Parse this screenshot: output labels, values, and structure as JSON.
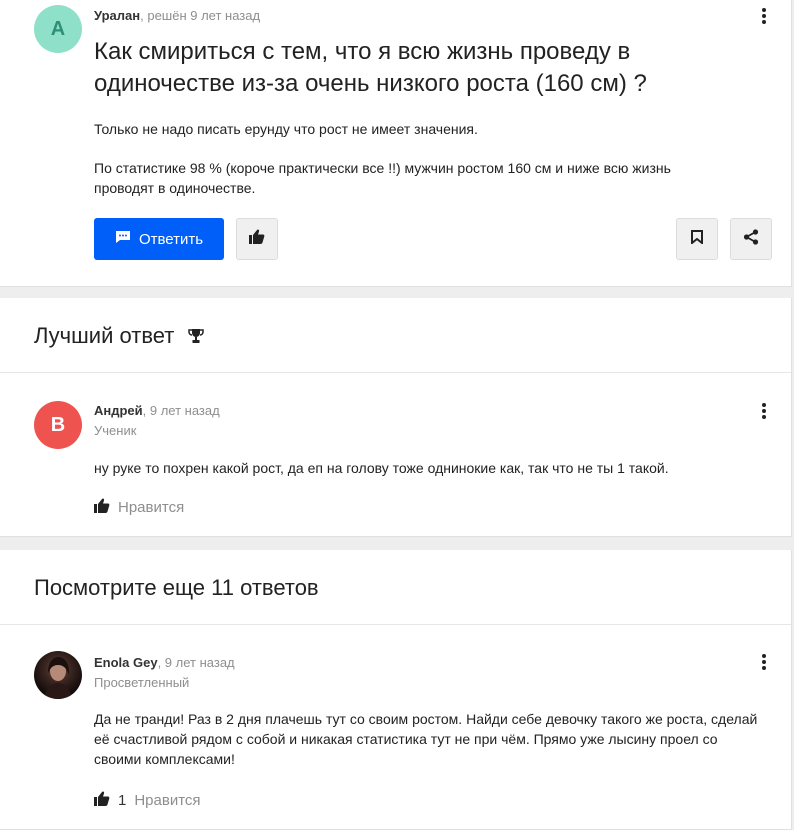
{
  "question": {
    "avatar_letter": "А",
    "avatar_color": "#8ee0c9",
    "author": "Уралан",
    "meta": ", решён 9 лет назад",
    "title": "Как смириться с тем, что я всю жизнь проведу в одиночестве из-за очень низкого роста (160 см) ?",
    "body": [
      "Только не надо писать ерунду что рост не имеет значения.",
      "По статистике 98 % (короче практически все !!) мужчин ростом 160 см и ниже всю жизнь проводят в одиночестве."
    ],
    "answer_button": "Ответить",
    "accent": "#005ff9"
  },
  "best_answer": {
    "section_title": "Лучший ответ",
    "trophy_icon": "trophy-icon",
    "avatar_letter": "В",
    "avatar_color": "#ef5350",
    "author": "Андрей",
    "meta": ", 9 лет назад",
    "role": "Ученик",
    "text": "ну руке то похрен какой рост, да еп на голову тоже однинокие как, так что не ты 1 такой.",
    "like_label": "Нравится"
  },
  "more_answers": {
    "section_title": "Посмотрите еще 11 ответов",
    "answer": {
      "author": "Enola Gey",
      "meta": ", 9 лет назад",
      "role": "Просветленный",
      "text": "Да не транди! Раз в 2 дня плачешь тут со своим ростом. Найди себе девочку такого же роста, сделай её счастливой рядом с собой и никакая статистика тут не при чём. Прямо уже лысину проел со своими комплексами!",
      "like_count": "1",
      "like_label": "Нравится"
    }
  }
}
